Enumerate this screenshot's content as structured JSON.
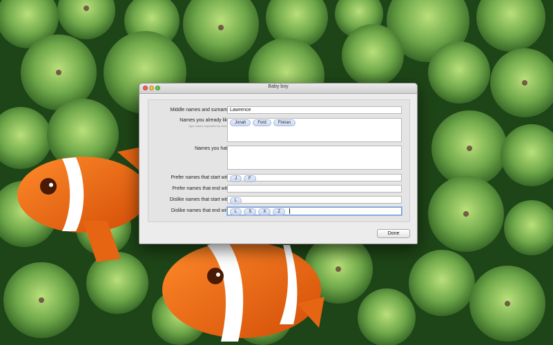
{
  "window": {
    "title": "Baby boy"
  },
  "form": {
    "middle_names_label": "Middle names and surname:",
    "middle_names_value": "Lawrence",
    "names_like_label": "Names you already like:",
    "names_like_hint": "Type names separated by commas",
    "names_like_tokens": [
      "Jonah",
      "Ford",
      "Florian"
    ],
    "names_hate_label": "Names you hate:",
    "prefer_start_label": "Prefer names that start with:",
    "prefer_start_tokens": [
      "J",
      "F"
    ],
    "prefer_end_label": "Prefer names that end with:",
    "dislike_start_label": "Dislike names that start with:",
    "dislike_start_tokens": [
      "L"
    ],
    "dislike_end_label": "Dislike names that end with:",
    "dislike_end_tokens": [
      "L",
      "S",
      "X",
      "Z"
    ]
  },
  "buttons": {
    "done_label": "Done"
  }
}
